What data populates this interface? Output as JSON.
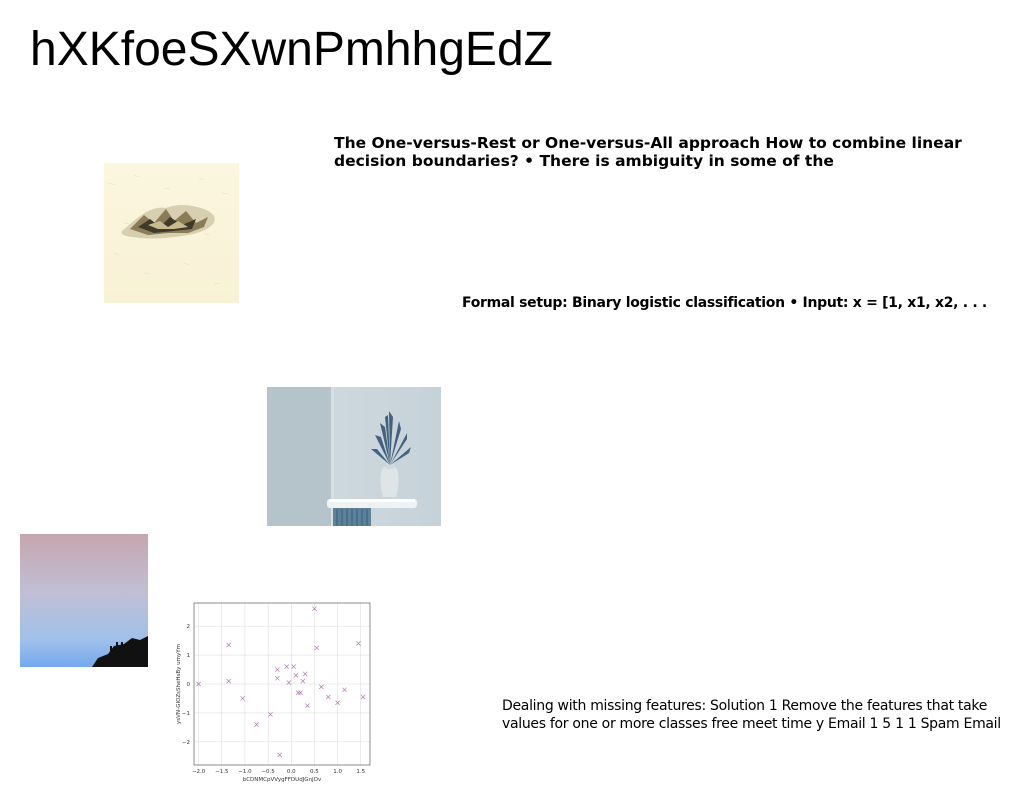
{
  "title": "hXKfoeSXwnPmhhgEdZ",
  "paragraphs": {
    "p1": "The One-versus-Rest or One-versus-All approach How to combine linear decision boundaries? • There is ambiguity in some of the",
    "p2": "Formal setup: Binary logistic classification • Input: x = [1, x1, x2, . . .",
    "p3": "Dealing with missing features: Solution 1 Remove the features that take values for one or more classes free meet time y Email 1 5 1 1 Spam Email"
  },
  "chart_data": {
    "type": "scatter",
    "xlabel": "bCDNMCpVVygFFDUdJGnJOv",
    "ylabel": "ysVN-GIOZsSheHsBy umyYm",
    "xlim": [
      -2.1,
      1.7
    ],
    "ylim": [
      -2.8,
      2.8
    ],
    "xticks": [
      "−2.0",
      "−1.5",
      "−1.0",
      "−0.5",
      "0.0",
      "0.5",
      "1.0",
      "1.5"
    ],
    "yticks": [
      "2",
      "1",
      "0",
      "−1",
      "−2"
    ],
    "grid": true,
    "marker": "x",
    "color": "#b07ab0",
    "points": [
      {
        "x": -2.0,
        "y": 0.0
      },
      {
        "x": -1.35,
        "y": 1.35
      },
      {
        "x": -1.35,
        "y": 0.1
      },
      {
        "x": -1.05,
        "y": -0.5
      },
      {
        "x": -0.75,
        "y": -1.4
      },
      {
        "x": -0.45,
        "y": -1.05
      },
      {
        "x": -0.3,
        "y": 0.5
      },
      {
        "x": -0.3,
        "y": 0.2
      },
      {
        "x": -0.25,
        "y": -2.45
      },
      {
        "x": -0.1,
        "y": 0.6
      },
      {
        "x": -0.05,
        "y": 0.05
      },
      {
        "x": 0.05,
        "y": 0.6
      },
      {
        "x": 0.1,
        "y": 0.3
      },
      {
        "x": 0.15,
        "y": -0.3
      },
      {
        "x": 0.2,
        "y": -0.3
      },
      {
        "x": 0.25,
        "y": 0.1
      },
      {
        "x": 0.3,
        "y": 0.35
      },
      {
        "x": 0.35,
        "y": -0.75
      },
      {
        "x": 0.5,
        "y": 2.6
      },
      {
        "x": 0.55,
        "y": 1.25
      },
      {
        "x": 0.65,
        "y": -0.1
      },
      {
        "x": 0.8,
        "y": -0.45
      },
      {
        "x": 1.0,
        "y": -0.65
      },
      {
        "x": 1.15,
        "y": -0.2
      },
      {
        "x": 1.45,
        "y": 1.4
      },
      {
        "x": 1.55,
        "y": -0.45
      }
    ]
  },
  "images": {
    "img1": "crumpled-paper-photo",
    "img2": "vase-with-plant-photo",
    "img3": "sky-silhouette-photo"
  }
}
